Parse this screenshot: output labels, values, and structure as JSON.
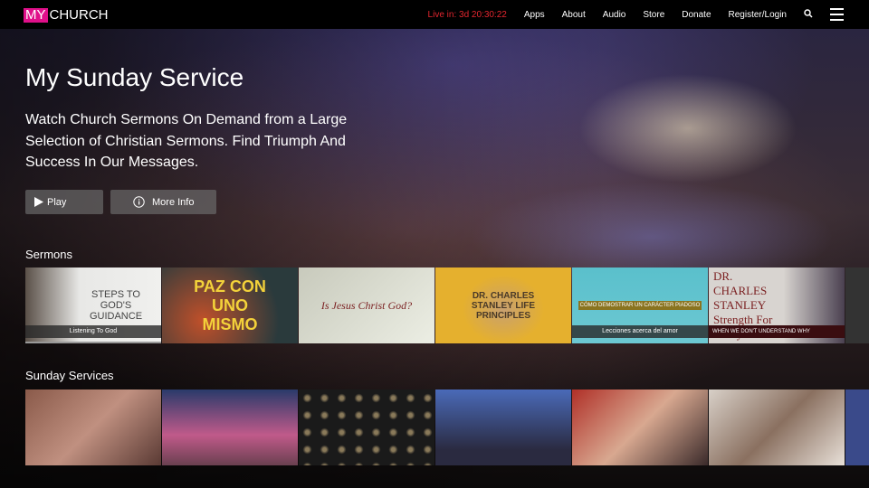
{
  "header": {
    "logo_my": "MY",
    "logo_church": "CHURCH",
    "live": "Live in: 3d 20:30:22",
    "nav": [
      "Apps",
      "About",
      "Audio",
      "Store",
      "Donate",
      "Register/Login"
    ]
  },
  "hero": {
    "title": "My Sunday Service",
    "description": "Watch Church Sermons On Demand from a Large Selection of Christian Sermons. Find Triumph And Success In Our Messages.",
    "play": "Play",
    "more_info": "More Info"
  },
  "sermons": {
    "label": "Sermons",
    "items": [
      {
        "title": "STEPS TO GOD'S GUIDANCE",
        "caption": "Listening To God",
        "progress": 1.0
      },
      {
        "title": "PAZ CON UNO MISMO",
        "caption": ""
      },
      {
        "title": "Is Jesus Christ God?",
        "caption": ""
      },
      {
        "title": "DR. CHARLES STANLEY LIFE PRINCIPLES",
        "caption": ""
      },
      {
        "title": "CÓMO DEMOSTRAR UN CARÁCTER PIADOSO",
        "caption": "Lecciones acerca del amor"
      },
      {
        "title": "DR. CHARLES STANLEY Strength For Today",
        "caption": "WHEN WE DON'T UNDERSTAND WHY"
      }
    ]
  },
  "services": {
    "label": "Sunday Services"
  }
}
